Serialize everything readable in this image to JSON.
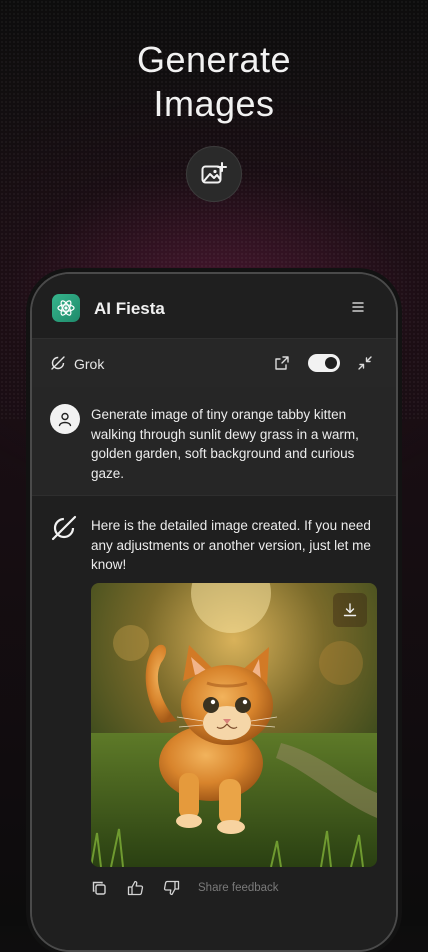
{
  "hero": {
    "title_line1": "Generate",
    "title_line2": "Images",
    "icon": "image-plus-icon"
  },
  "app": {
    "title": "AI Fiesta",
    "logo_icon": "atom-logo-icon",
    "menu_icon": "hamburger-menu-icon"
  },
  "model_bar": {
    "model_name": "Grok",
    "model_icon": "grok-icon",
    "share_icon": "share-external-icon",
    "toggle_on": true,
    "collapse_icon": "collapse-arrows-icon"
  },
  "chat": {
    "user_message": "Generate image of tiny orange tabby kitten walking through sunlit dewy grass in a warm, golden garden, soft background and curious gaze.",
    "bot_message": "Here is the detailed image created. If you need any adjustments or another version, just let me know!",
    "image_alt": "orange tabby kitten walking through sunlit grass",
    "download_icon": "download-icon"
  },
  "actions": {
    "copy_icon": "copy-icon",
    "like_icon": "thumbs-up-icon",
    "dislike_icon": "thumbs-down-icon",
    "feedback_label": "Share feedback"
  },
  "colors": {
    "accent_logo": "#36b58c",
    "background": "#0d0d0d",
    "panel": "#1f1f1f"
  }
}
